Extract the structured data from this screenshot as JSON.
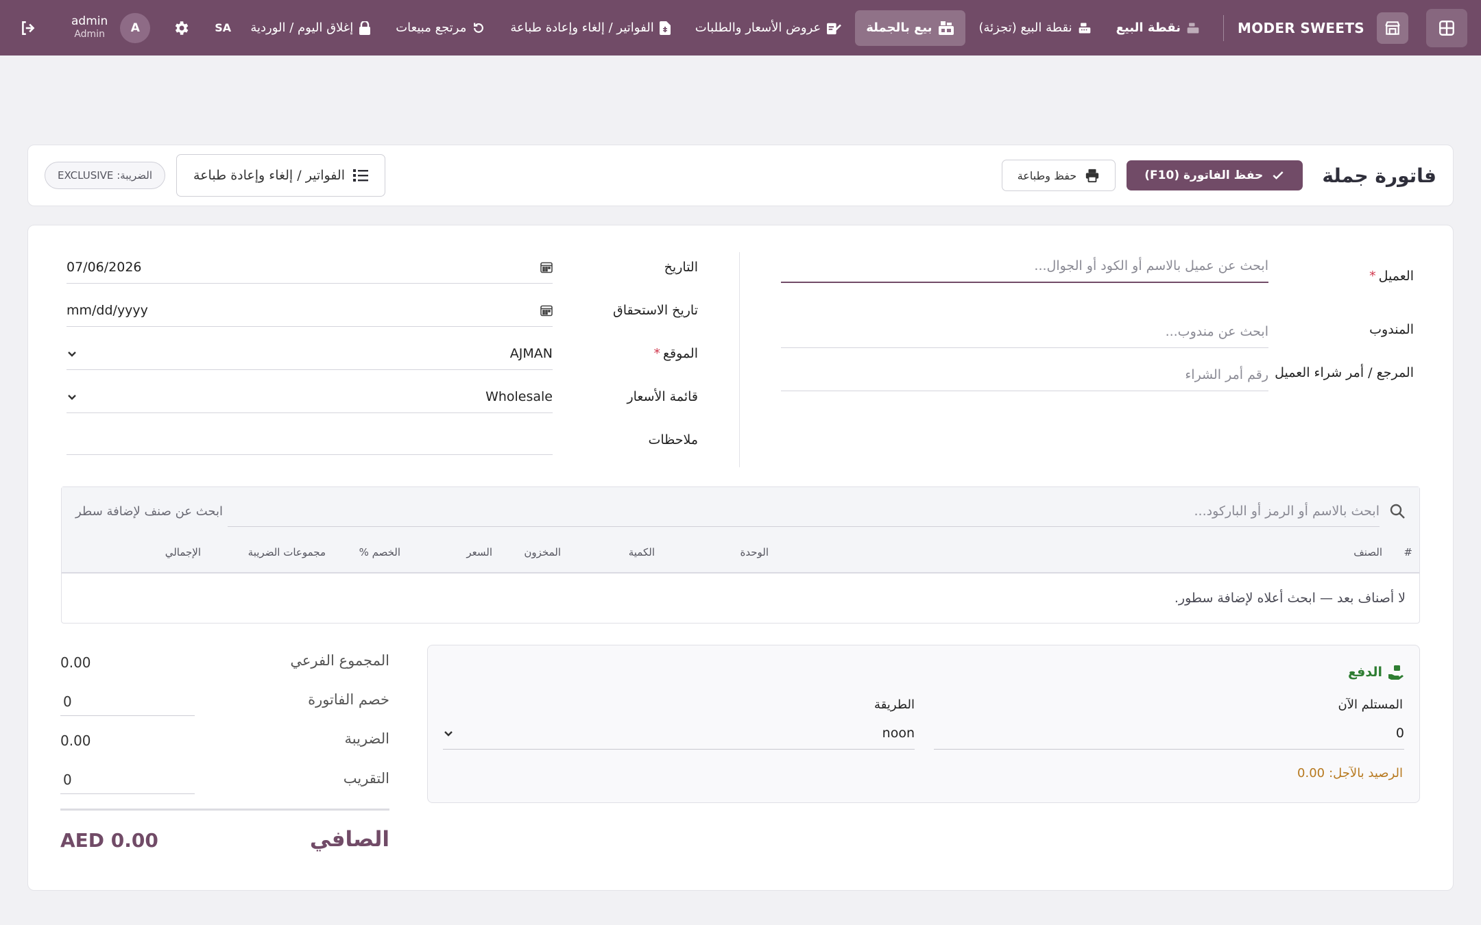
{
  "navbar": {
    "brand": "MODER SWEETS",
    "items": [
      {
        "label": "نقطة البيع",
        "icon": "cash-register-icon"
      },
      {
        "label": "نقطة البيع (تجزئة)",
        "icon": "cash-register-icon"
      },
      {
        "label": "بيع بالجملة",
        "icon": "wholesale-icon",
        "active": true
      },
      {
        "label": "عروض الأسعار والطلبات",
        "icon": "edit-document-icon"
      },
      {
        "label": "الفواتير / إلغاء وإعادة طباعة",
        "icon": "invoice-file-icon"
      },
      {
        "label": "مرتجع مبيعات",
        "icon": "undo-icon"
      },
      {
        "label": "إغلاق اليوم / الوردية",
        "icon": "lock-icon"
      }
    ],
    "company_code": "SA",
    "user": {
      "initial": "A",
      "name": "admin",
      "role": "Admin"
    }
  },
  "header": {
    "title": "فاتورة جملة",
    "save_button": "حفظ الفاتورة (F10)",
    "save_print_button": "حفظ وطباعة",
    "invoices_button": "الفواتير / إلغاء وإعادة طباعة",
    "tax_badge": "الضريبة: EXCLUSIVE"
  },
  "form": {
    "customer": {
      "label": "العميل",
      "required_mark": "*",
      "placeholder": "ابحث عن عميل بالاسم أو الكود أو الجوال..."
    },
    "rep": {
      "label": "المندوب",
      "placeholder": "ابحث عن مندوب..."
    },
    "reference": {
      "label": "المرجع / أمر شراء العميل",
      "placeholder": "رقم أمر الشراء"
    },
    "date": {
      "label": "التاريخ",
      "value": "07/06/2026"
    },
    "due_date": {
      "label": "تاريخ الاستحقاق",
      "value": "mm/dd/yyyy"
    },
    "location": {
      "label": "الموقع",
      "required_mark": "*",
      "value": "AJMAN"
    },
    "price_list": {
      "label": "قائمة الأسعار",
      "value": "Wholesale"
    },
    "notes": {
      "label": "ملاحظات",
      "value": ""
    }
  },
  "lines": {
    "search_placeholder": "ابحث بالاسم أو الرمز أو الباركود...",
    "search_hint": "ابحث عن صنف لإضافة سطر",
    "columns": [
      "#",
      "الصنف",
      "الوحدة",
      "الكمية",
      "المخزون",
      "السعر",
      "الخصم %",
      "مجموعات الضريبة",
      "الإجمالي"
    ],
    "empty_message": "لا أصناف بعد — ابحث أعلاه لإضافة سطور."
  },
  "payment": {
    "title": "الدفع",
    "received_label": "المستلم الآن",
    "received_value": "0",
    "method_label": "الطريقة",
    "method_value": "noon",
    "deferred_label": "الرصيد بالآجل:",
    "deferred_value": "0.00"
  },
  "totals": {
    "subtotal_label": "المجموع الفرعي",
    "subtotal_value": "0.00",
    "discount_label": "خصم الفاتورة",
    "discount_value": "0",
    "tax_label": "الضريبة",
    "tax_value": "0.00",
    "rounding_label": "التقريب",
    "rounding_value": "0",
    "net_label": "الصافي",
    "net_value": "AED 0.00"
  },
  "colors": {
    "brand": "#714b67",
    "success": "#2e7d32",
    "warning": "#b7791f"
  }
}
